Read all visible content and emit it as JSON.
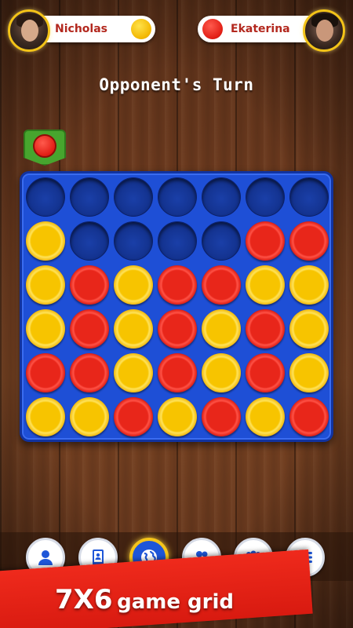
{
  "players": {
    "left": {
      "name": "Nicholas",
      "chip_color": "yellow"
    },
    "right": {
      "name": "Ekaterina",
      "chip_color": "red"
    }
  },
  "status": {
    "turn_text": "Opponent's Turn"
  },
  "drop_marker": {
    "chip_color": "red",
    "column": 1
  },
  "board": {
    "columns": 7,
    "rows": 6,
    "cells": [
      [
        "E",
        "E",
        "E",
        "E",
        "E",
        "E",
        "E"
      ],
      [
        "Y",
        "E",
        "E",
        "E",
        "E",
        "R",
        "R"
      ],
      [
        "Y",
        "R",
        "Y",
        "R",
        "R",
        "Y",
        "Y"
      ],
      [
        "Y",
        "R",
        "Y",
        "R",
        "Y",
        "R",
        "Y"
      ],
      [
        "R",
        "R",
        "Y",
        "R",
        "Y",
        "R",
        "Y"
      ],
      [
        "Y",
        "Y",
        "R",
        "Y",
        "R",
        "Y",
        "R"
      ]
    ]
  },
  "nav": {
    "items": [
      {
        "icon": "profile-icon"
      },
      {
        "icon": "phone-contact-icon"
      },
      {
        "icon": "globe-icon",
        "active": true
      },
      {
        "icon": "friends-icon"
      },
      {
        "icon": "groups-icon"
      },
      {
        "icon": "menu-icon"
      }
    ]
  },
  "banner": {
    "size_text": "7X6",
    "caption": "game grid"
  },
  "colors": {
    "board_blue": "#1e4fd6",
    "chip_red": "#e8261a",
    "chip_yellow": "#f7c400",
    "banner_red": "#e0221a",
    "accent_gold": "#f5c51a",
    "marker_green": "#47a52e"
  }
}
